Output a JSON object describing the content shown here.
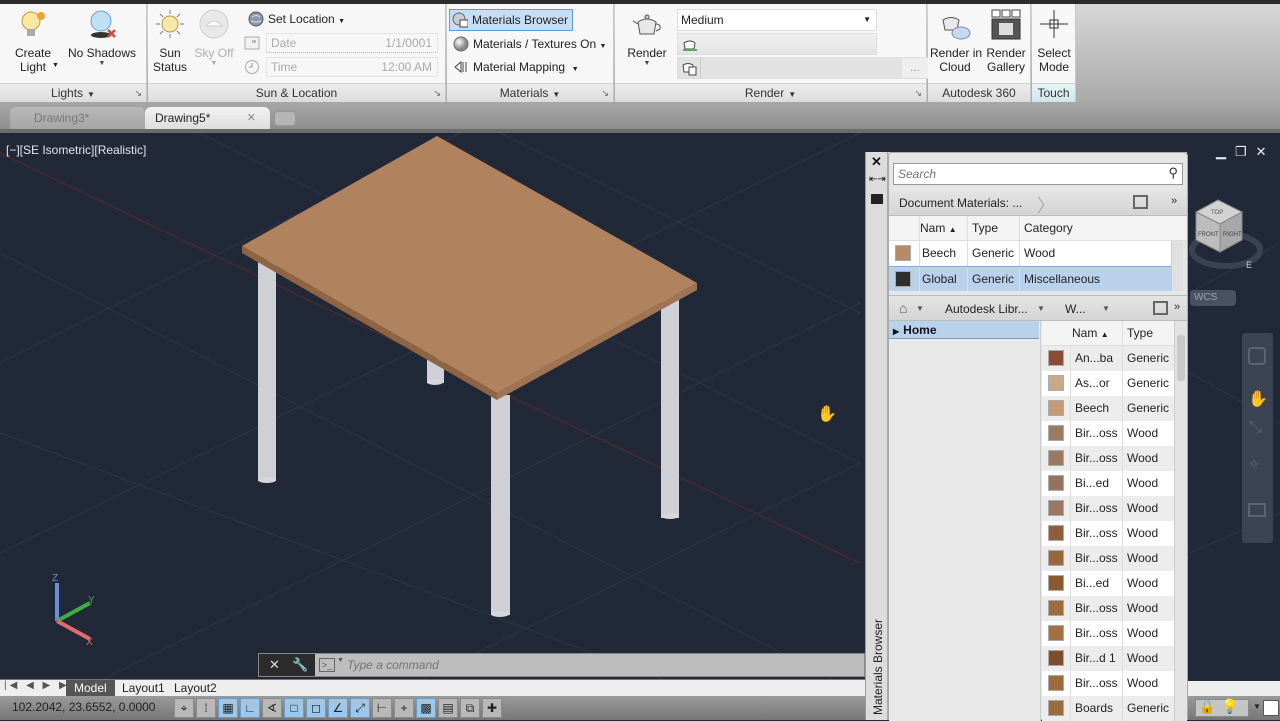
{
  "ribbon": {
    "lights": {
      "title": "Lights",
      "create_light": [
        "Create",
        "Light"
      ],
      "no_shadows": "No Shadows"
    },
    "sun_location": {
      "title": "Sun & Location",
      "sun_status": [
        "Sun",
        "Status"
      ],
      "sky_off": "Sky Off",
      "set_location": "Set Location",
      "date_label": "Date",
      "date_value": "1/1/0001",
      "time_label": "Time",
      "time_value": "12:00 AM"
    },
    "materials": {
      "title": "Materials",
      "materials_browser": "Materials Browser",
      "materials_textures": "Materials / Textures On",
      "material_mapping": "Material Mapping"
    },
    "render": {
      "title": "Render",
      "render_button": "Render",
      "quality": "Medium",
      "more": "..."
    },
    "autodesk360": {
      "title": "Autodesk 360",
      "render_cloud": [
        "Render in",
        "Cloud"
      ],
      "render_gallery": [
        "Render",
        "Gallery"
      ]
    },
    "touch": {
      "title": "Touch",
      "select_mode": [
        "Select",
        "Mode"
      ]
    }
  },
  "tabs": [
    {
      "label": "Drawing3*",
      "active": false
    },
    {
      "label": "Drawing5*",
      "active": true
    }
  ],
  "viewport": {
    "label": "[−][SE Isometric][Realistic]",
    "viewcube": {
      "top": "TOP",
      "front": "FRONT",
      "right": "RIGHT",
      "compass": "E"
    },
    "wcs": "WCS",
    "ucs": {
      "x": "X",
      "y": "Y",
      "z": "Z"
    }
  },
  "materials_browser": {
    "title": "Materials Browser",
    "search_placeholder": "Search",
    "doc_breadcrumb": "Document Materials: ...",
    "doc_columns": [
      "Nam",
      "Type",
      "Category"
    ],
    "doc_rows": [
      {
        "name": "Beech",
        "type": "Generic",
        "category": "Wood",
        "swatch": "#b88a68",
        "selected": false
      },
      {
        "name": "Global",
        "type": "Generic",
        "category": "Miscellaneous",
        "swatch": "#2e2e2e",
        "selected": true
      }
    ],
    "lib_breadcrumb": [
      "Autodesk Libr...",
      "W..."
    ],
    "tree": [
      "Home"
    ],
    "lib_columns": [
      "Nam",
      "Type"
    ],
    "lib_rows": [
      {
        "name": "An...ba",
        "type": "Generic",
        "swatch": "#8b4a34"
      },
      {
        "name": "As...or",
        "type": "Generic",
        "swatch": "#c8a88a"
      },
      {
        "name": "Beech",
        "type": "Generic",
        "swatch": "#c49a72"
      },
      {
        "name": "Bir...oss",
        "type": "Wood",
        "swatch": "#9c7a60"
      },
      {
        "name": "Bir...oss",
        "type": "Wood",
        "swatch": "#9a7760"
      },
      {
        "name": "Bi...ed",
        "type": "Wood",
        "swatch": "#95725c"
      },
      {
        "name": "Bir...oss",
        "type": "Wood",
        "swatch": "#9a7660"
      },
      {
        "name": "Bir...oss",
        "type": "Wood",
        "swatch": "#8e5f3a"
      },
      {
        "name": "Bir...oss",
        "type": "Wood",
        "swatch": "#99673c"
      },
      {
        "name": "Bi...ed",
        "type": "Wood",
        "swatch": "#8a5a30"
      },
      {
        "name": "Bir...oss",
        "type": "Wood",
        "swatch": "#a06e3e"
      },
      {
        "name": "Bir...oss",
        "type": "Wood",
        "swatch": "#a3703f"
      },
      {
        "name": "Bir...d 1",
        "type": "Wood",
        "swatch": "#7e4e2c"
      },
      {
        "name": "Bir...oss",
        "type": "Wood",
        "swatch": "#a06b3a"
      },
      {
        "name": "Boards",
        "type": "Generic",
        "swatch": "#9c6c3a"
      }
    ]
  },
  "command": {
    "placeholder": "Type a command"
  },
  "layouts": [
    "Model",
    "Layout1",
    "Layout2"
  ],
  "status": {
    "coords": "102.2042, 23.6552, 0.0000"
  },
  "colors": {
    "viewport_bg": "#212938",
    "table_top": "#b0835e",
    "selection": "#b9d1ea",
    "accent": "#3c7fc6"
  }
}
